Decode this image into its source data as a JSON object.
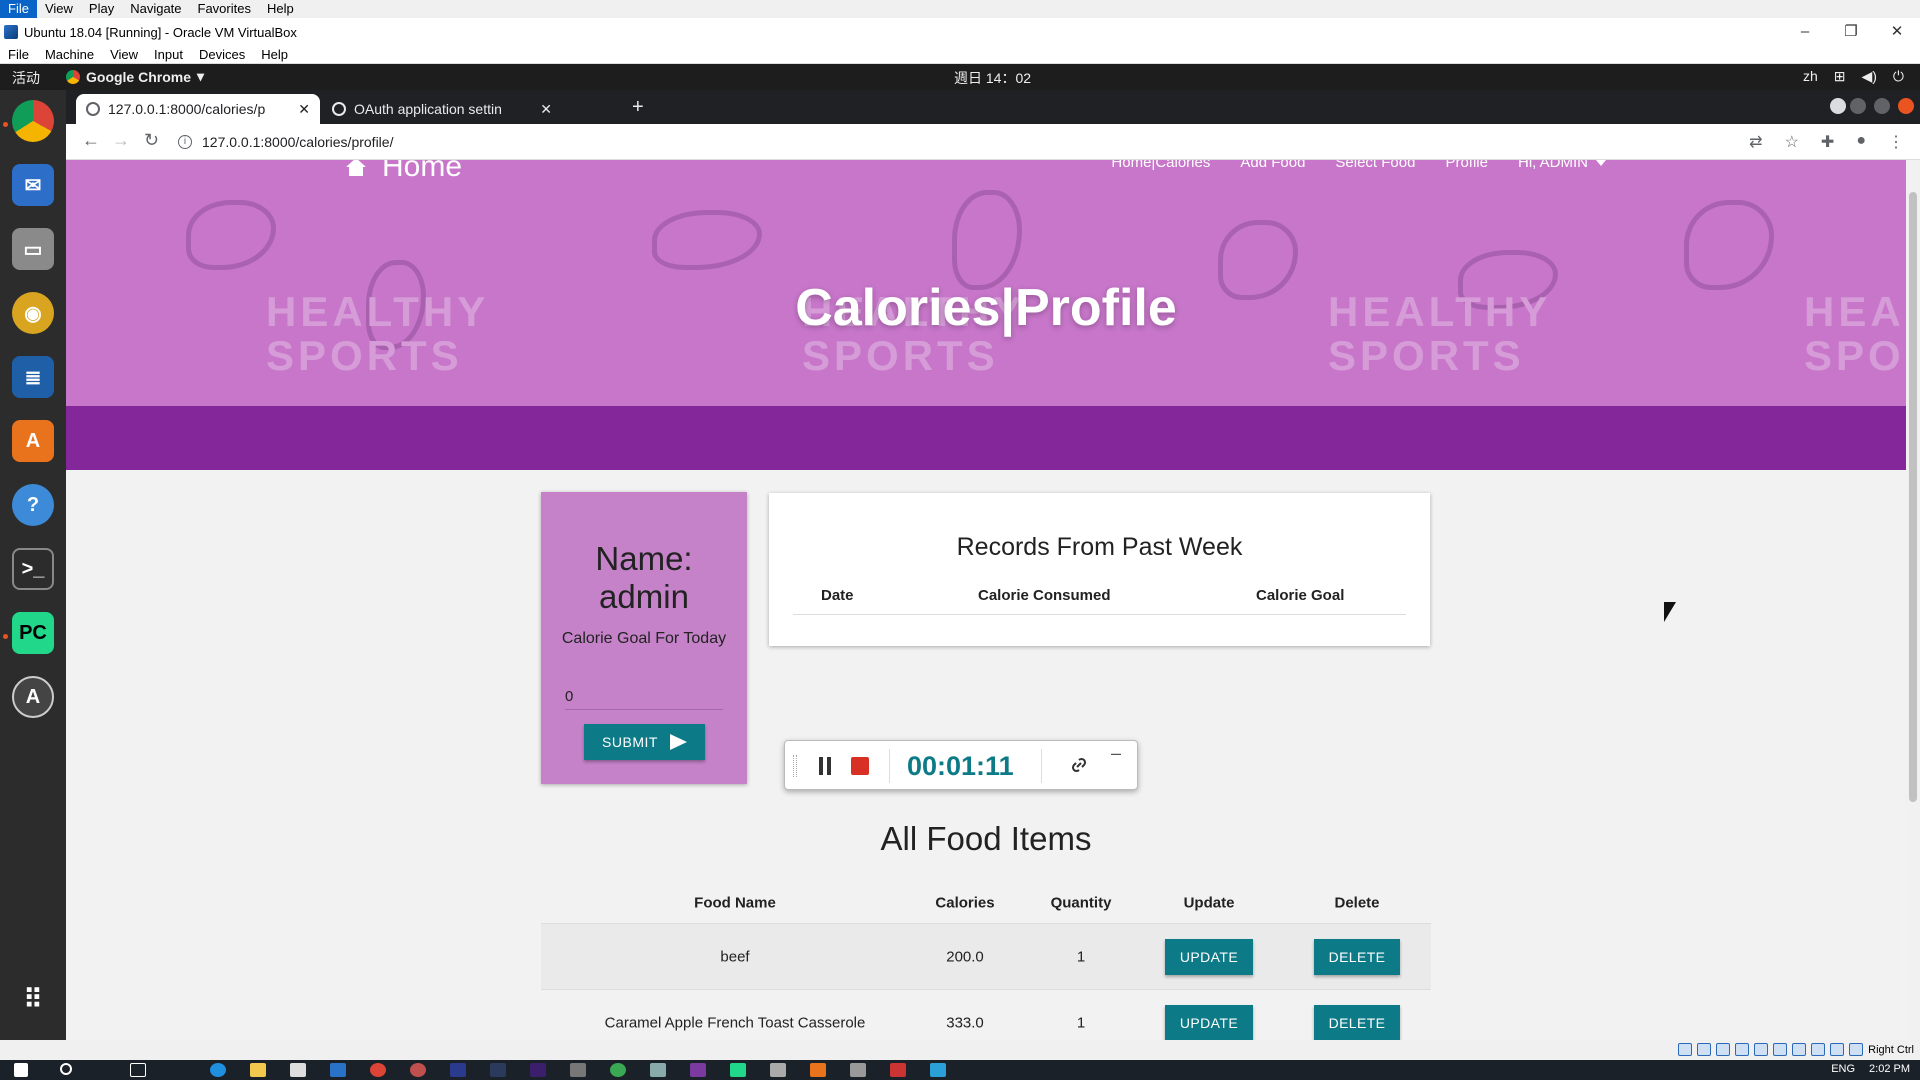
{
  "vbox": {
    "menu": [
      "File",
      "View",
      "Play",
      "Navigate",
      "Favorites",
      "Help"
    ],
    "title": "Ubuntu 18.04 [Running] - Oracle VM VirtualBox",
    "vm_menu": [
      "File",
      "Machine",
      "View",
      "Input",
      "Devices",
      "Help"
    ],
    "host_key": "Right Ctrl"
  },
  "ubuntu": {
    "activities": "活动",
    "app_menu": "Google Chrome",
    "clock": "週日 14：02",
    "lang": "zh"
  },
  "chrome": {
    "tabs": [
      {
        "title": "127.0.0.1:8000/calories/p",
        "active": true
      },
      {
        "title": "OAuth application settin",
        "active": false
      }
    ],
    "url": "127.0.0.1:8000/calories/profile/"
  },
  "site": {
    "brand": "Home",
    "nav": [
      "Home|Calories",
      "Add Food",
      "Select Food",
      "Profile",
      "Hi, ADMIN"
    ],
    "hero_title": "Calories|Profile",
    "hero_watermark": [
      "HEALTHY",
      "SPORTS"
    ],
    "colors": {
      "hero": "#c776c9",
      "band": "#84279a",
      "button": "#0d7a87"
    }
  },
  "profile": {
    "name_label": "Name:",
    "name_value": "admin",
    "goal_label": "Calorie Goal For Today",
    "goal_value": "0",
    "submit_label": "SUBMIT"
  },
  "records": {
    "title": "Records From Past Week",
    "columns": [
      "Date",
      "Calorie Consumed",
      "Calorie Goal"
    ]
  },
  "recorder": {
    "time": "00:01:11"
  },
  "food": {
    "title": "All Food Items",
    "columns": [
      "Food Name",
      "Calories",
      "Quantity",
      "Update",
      "Delete"
    ],
    "rows": [
      {
        "name": "beef",
        "calories": "200.0",
        "quantity": "1",
        "update": "UPDATE",
        "delete": "DELETE"
      },
      {
        "name": "Caramel Apple French Toast Casserole",
        "calories": "333.0",
        "quantity": "1",
        "update": "UPDATE",
        "delete": "DELETE"
      }
    ]
  },
  "taskbar": {
    "time": "2:02 PM",
    "lang": "ENG"
  }
}
